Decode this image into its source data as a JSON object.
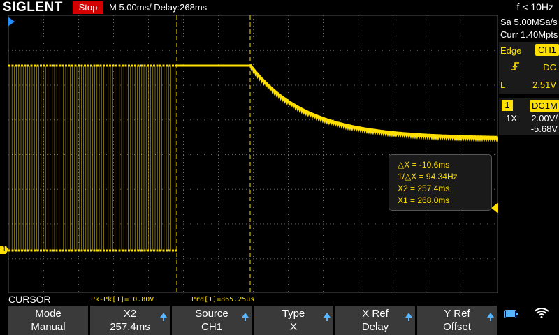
{
  "header": {
    "brand": "SIGLENT",
    "run_state": "Stop",
    "timebase": "M 5.00ms/ Delay:268ms",
    "trigger_freq": "f < 10Hz"
  },
  "acquisition": {
    "sample_rate": "Sa 5.00MSa/s",
    "memory_depth": "Curr 1.40Mpts"
  },
  "trigger": {
    "type_label": "Edge",
    "source": "CH1",
    "coupling": "DC",
    "level_label": "L",
    "level": "2.51V"
  },
  "channel1": {
    "number": "1",
    "coupling": "DC1M",
    "probe": "1X",
    "scale": "2.00V/",
    "offset": "-5.68V"
  },
  "cursor_readout": {
    "delta_x": "△X = -10.6ms",
    "inv_delta_x": "1/△X = 94.34Hz",
    "x2": "X2 = 257.4ms",
    "x1": "X1 = 268.0ms"
  },
  "measurements": {
    "mode_label": "CURSOR",
    "pk_pk": "Pk-Pk[1]=10.80V",
    "period": "Prd[1]=865.25us"
  },
  "softkeys": [
    {
      "title": "Mode",
      "value": "Manual",
      "arrow": false
    },
    {
      "title": "X2",
      "value": "257.4ms",
      "arrow": true
    },
    {
      "title": "Source",
      "value": "CH1",
      "arrow": true
    },
    {
      "title": "Type",
      "value": "X",
      "arrow": true
    },
    {
      "title": "X Ref",
      "value": "Delay",
      "arrow": true
    },
    {
      "title": "Y Ref",
      "value": "Offset",
      "arrow": true
    }
  ],
  "colors": {
    "trace": "#ffe000",
    "stop_badge": "#d40000",
    "accent_blue": "#58b4ff"
  },
  "icons": {
    "trigger_edge": "rising-edge-icon",
    "battery": "battery-icon",
    "wifi": "wifi-icon"
  }
}
